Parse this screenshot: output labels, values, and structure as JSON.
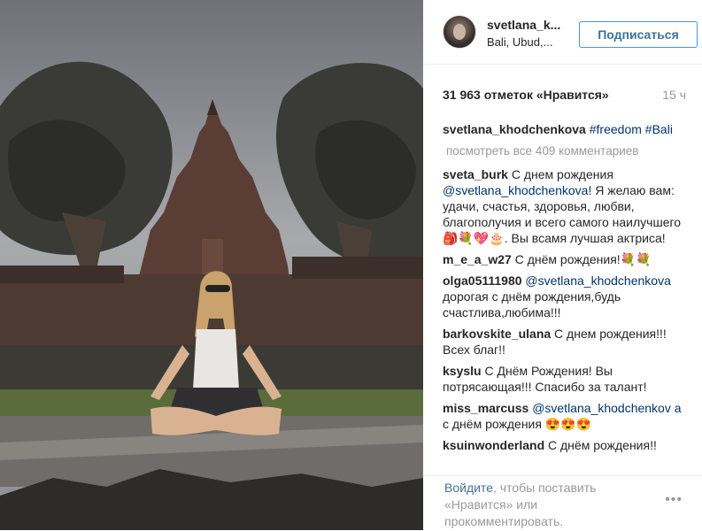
{
  "post": {
    "username": "svetlana_k...",
    "location": "Bali, Ubud,...",
    "follow_label": "Подписаться",
    "likes_text": "31 963 отметок «Нравится»",
    "time_ago": "15 ч"
  },
  "caption": {
    "user": "svetlana_khodchenkova",
    "tag1": "#freedom",
    "tag2": "#Bali"
  },
  "view_all": "посмотреть все 409 комментариев",
  "comments": [
    {
      "user": "sveta_burk",
      "pre": " С днем рождения ",
      "mention": "@svetlana_khodchenkova",
      "post": "! Я желаю вам: удачи, счастья, здоровья, любви, благополучия и всего самого наилучшего🎒💐💖🎂. Вы всамя лучшая актриса!"
    },
    {
      "user": "m_e_a_w27",
      "pre": " С днём рождения!💐💐",
      "mention": "",
      "post": ""
    },
    {
      "user": "olga05111980",
      "pre": " ",
      "mention": "@svetlana_khodchenkova",
      "post": " дорогая с днём рождения,будь счастлива,любима!!!"
    },
    {
      "user": "barkovskite_ulana",
      "pre": " С днем рождения!!! Всех благ!!",
      "mention": "",
      "post": ""
    },
    {
      "user": "ksyslu",
      "pre": " С Днём Рождения! Вы потрясающая!!! Спасибо за талант!",
      "mention": "",
      "post": ""
    },
    {
      "user": "miss_marcuss",
      "pre": " ",
      "mention": "@svetlana_khodchenkov a",
      "post": " с днём рождения 😍😍😍"
    },
    {
      "user": "ksuinwonderland",
      "pre": " С днём рождения!!",
      "mention": "",
      "post": ""
    }
  ],
  "footer": {
    "login_link": "Войдите",
    "login_text": ", чтобы поставить «Нравится» или прокомментировать.",
    "more_icon": "ellipsis-icon"
  }
}
